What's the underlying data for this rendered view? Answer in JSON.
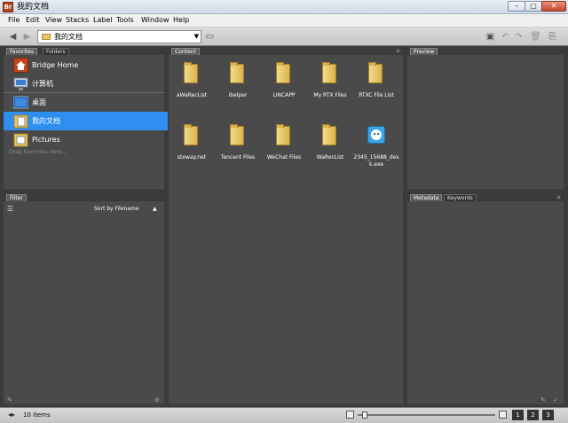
{
  "window": {
    "title": "我的文档",
    "app_icon": "Br",
    "min": "–",
    "max": "□",
    "close": "✕"
  },
  "menu": [
    "File",
    "Edit",
    "View",
    "Stacks",
    "Label",
    "Tools",
    "Window",
    "Help"
  ],
  "toolbar": {
    "back_icon": "◀",
    "forward_icon": "▶",
    "path_label": "我的文档",
    "dropdown_icon": "▼",
    "right_icons": [
      "▣",
      "↶",
      "↷",
      "🗑",
      "⎘"
    ]
  },
  "favorites": {
    "tabs": [
      "Favorites",
      "Folders"
    ],
    "items": [
      {
        "label": "Bridge Home",
        "icon": "bridge-home-icon",
        "selected": false
      },
      {
        "label": "计算机",
        "icon": "computer-icon",
        "selected": false
      },
      {
        "label": "桌面",
        "icon": "desktop-icon",
        "selected": false
      },
      {
        "label": "我的文档",
        "icon": "documents-icon",
        "selected": true
      },
      {
        "label": "Pictures",
        "icon": "pictures-icon",
        "selected": false
      }
    ],
    "hint": "Drag Favorites Here..."
  },
  "filter": {
    "tab": "Filter",
    "sort_label": "Sort by Filename",
    "sort_arrow": "▲"
  },
  "content": {
    "tab": "Content",
    "items": [
      {
        "label": "aWaRecList",
        "type": "folder"
      },
      {
        "label": "ibelper",
        "type": "folder"
      },
      {
        "label": "LINCAPP",
        "type": "folder"
      },
      {
        "label": "My RTX Files",
        "type": "folder"
      },
      {
        "label": "RTXC File List",
        "type": "folder"
      },
      {
        "label": "steway.net",
        "type": "folder"
      },
      {
        "label": "Tencent Files",
        "type": "folder"
      },
      {
        "label": "WeChat Files",
        "type": "folder"
      },
      {
        "label": "WaRecList",
        "type": "folder"
      },
      {
        "label": "2345_15688_desk.exe",
        "type": "exe"
      }
    ]
  },
  "preview": {
    "tab": "Preview"
  },
  "metadata": {
    "tabs": [
      "Metadata",
      "Keywords"
    ]
  },
  "status": {
    "items_count": "10 items",
    "views": [
      "1",
      "2",
      "3"
    ]
  },
  "colors": {
    "selected": "#2e8ff0",
    "panel": "#4a4a4a"
  }
}
